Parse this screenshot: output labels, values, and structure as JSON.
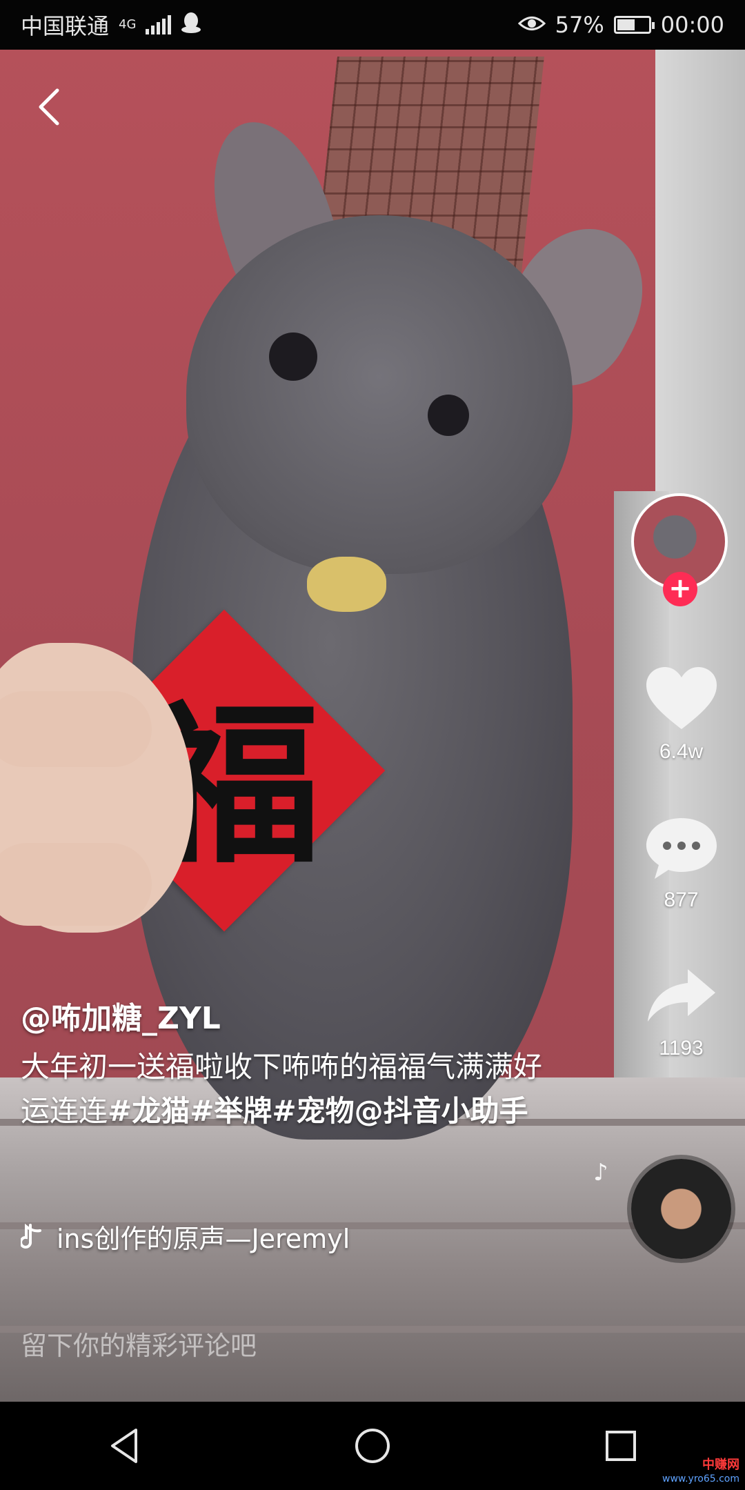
{
  "status_bar": {
    "carrier": "中国联通",
    "network": "4G",
    "battery": "57%",
    "battery_level": 0.57,
    "time": "00:00",
    "icons": [
      "signal-icon",
      "penguin-icon",
      "eye-icon",
      "battery-icon"
    ]
  },
  "video": {
    "fu_character": "福"
  },
  "actions": {
    "likes": "6.4w",
    "comments": "877",
    "shares": "1193"
  },
  "post": {
    "username": "@咘加糖_ZYL",
    "description_text": "大年初一送福啦收下咘咘的福福气满满好运连连",
    "tags": "#龙猫#举牌#宠物@",
    "mention": "抖音小助手",
    "music": "ins创作的原声—Jeremyl"
  },
  "comment": {
    "placeholder": "留下你的精彩评论吧"
  },
  "watermark": {
    "top": "中赚网",
    "bottom": "www.yro65.com"
  },
  "colors": {
    "accent": "#fe2c55",
    "fu_red": "#d91f2a"
  }
}
